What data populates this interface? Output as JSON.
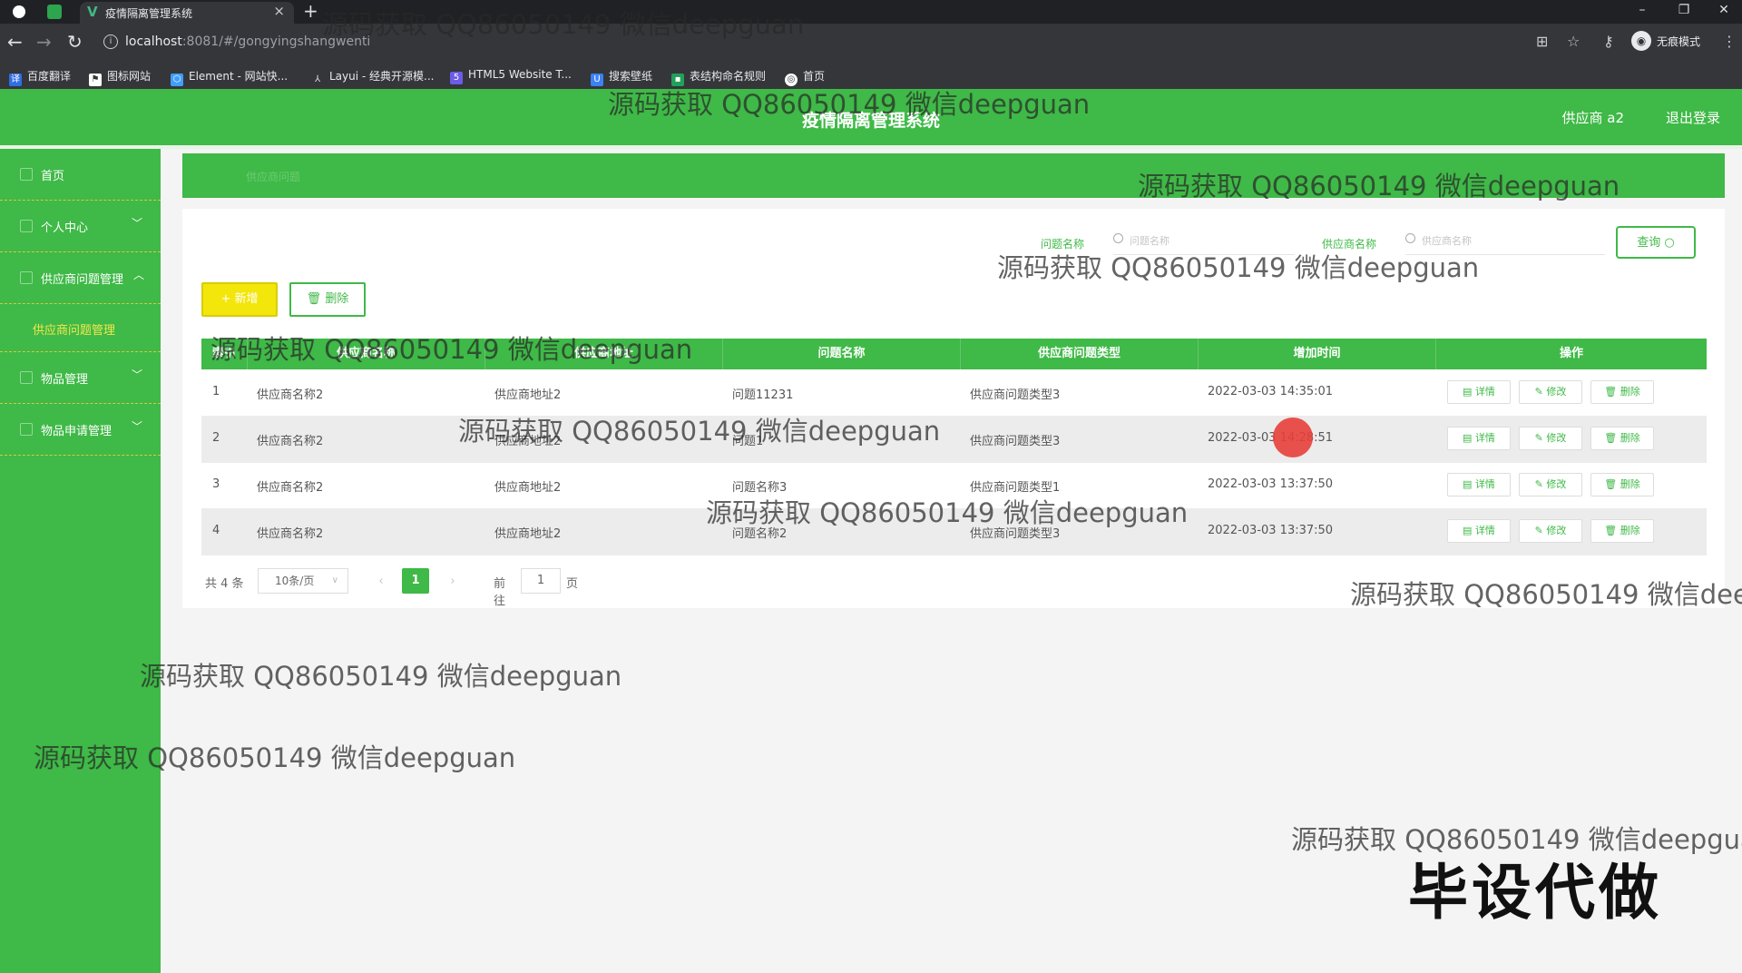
{
  "browser": {
    "tab_title": "疫情隔离管理系统",
    "url_host": "localhost",
    "url_rest": ":8081/#/gongyingshangwenti",
    "incognito_label": "无痕模式",
    "bookmarks": [
      "百度翻译",
      "图标网站",
      "Element - 网站快...",
      "Layui - 经典开源模...",
      "HTML5 Website T...",
      "搜索壁纸",
      "表结构命名规则",
      "首页"
    ]
  },
  "header": {
    "system_title": "疫情隔离管理系统",
    "user": "供应商 a2",
    "logout": "退出登录"
  },
  "sidebar": {
    "items": [
      {
        "label": "首页"
      },
      {
        "label": "个人中心"
      },
      {
        "label": "供应商问题管理"
      },
      {
        "label": "供应商问题管理"
      },
      {
        "label": "物品管理"
      },
      {
        "label": "物品申请管理"
      }
    ]
  },
  "breadcrumb": "供应商问题",
  "search": {
    "label1": "问题名称",
    "placeholder1": "问题名称",
    "label2": "供应商名称",
    "placeholder2": "供应商名称",
    "query_button": "查询"
  },
  "actions": {
    "add": "新增",
    "delete": "删除"
  },
  "table": {
    "headers": [
      "索引",
      "供应商名称",
      "供应商地址",
      "问题名称",
      "供应商问题类型",
      "增加时间",
      "操作"
    ],
    "rows": [
      {
        "index": "1",
        "supplier": "供应商名称2",
        "address": "供应商地址2",
        "problem": "问题11231",
        "type": "供应商问题类型3",
        "time": "2022-03-03 14:35:01"
      },
      {
        "index": "2",
        "supplier": "供应商名称2",
        "address": "供应商地址2",
        "problem": "问题1",
        "type": "供应商问题类型3",
        "time": "2022-03-03 14:28:51"
      },
      {
        "index": "3",
        "supplier": "供应商名称2",
        "address": "供应商地址2",
        "problem": "问题名称3",
        "type": "供应商问题类型1",
        "time": "2022-03-03 13:37:50"
      },
      {
        "index": "4",
        "supplier": "供应商名称2",
        "address": "供应商地址2",
        "problem": "问题名称2",
        "type": "供应商问题类型3",
        "time": "2022-03-03 13:37:50"
      }
    ],
    "ops": {
      "detail": "详情",
      "edit": "修改",
      "delete": "删除"
    }
  },
  "pagination": {
    "total": "共 4 条",
    "page_size": "10条/页",
    "current_page": "1",
    "goto_label": "前往",
    "goto_value": "1",
    "goto_unit": "页"
  },
  "overlay": {
    "watermark": "源码获取 QQ86050149 微信deepguan",
    "promo": "毕设代做"
  },
  "colors": {
    "primary_green": "#3fb947",
    "highlight_yellow": "#f2e60b",
    "cursor_red": "#e8403a"
  }
}
